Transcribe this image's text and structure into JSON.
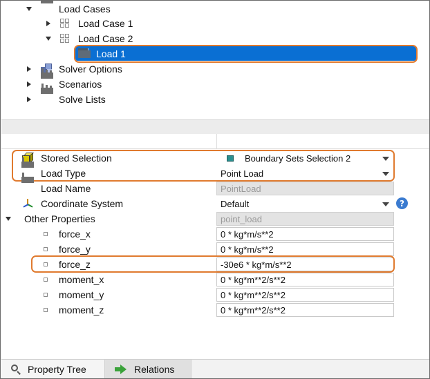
{
  "tree": {
    "items": [
      {
        "label": "Load Cases",
        "icon": "factory-icon",
        "expanded": true
      },
      {
        "label": "Load Case 1",
        "icon": "grid-icon",
        "expanded": false
      },
      {
        "label": "Load Case 2",
        "icon": "grid-icon",
        "expanded": true
      },
      {
        "label": "Load 1",
        "icon": "folder-icon",
        "selected": true
      },
      {
        "label": "Solver Options",
        "icon": "solver-icon",
        "expanded": false
      },
      {
        "label": "Scenarios",
        "icon": "factory-icon",
        "expanded": false
      },
      {
        "label": "Solve Lists",
        "icon": "factory-icon",
        "expanded": false
      }
    ]
  },
  "properties": {
    "stored_selection": {
      "label": "Stored Selection",
      "value": "Boundary Sets Selection 2",
      "icon": "cube-icon"
    },
    "load_type": {
      "label": "Load Type",
      "value": "Point Load",
      "icon": "factory-icon"
    },
    "load_name": {
      "label": "Load Name",
      "value": "PointLoad",
      "icon": "factory-icon"
    },
    "coordinate_system": {
      "label": "Coordinate System",
      "value": "Default",
      "icon": "axes-icon"
    },
    "other_properties": {
      "label": "Other Properties",
      "value": "point_load"
    },
    "force_x": {
      "label": "force_x",
      "value": "0 * kg*m/s**2"
    },
    "force_y": {
      "label": "force_y",
      "value": "0 * kg*m/s**2"
    },
    "force_z": {
      "label": "force_z",
      "value": "-30e6 * kg*m/s**2"
    },
    "moment_x": {
      "label": "moment_x",
      "value": "0 * kg*m**2/s**2"
    },
    "moment_y": {
      "label": "moment_y",
      "value": "0 * kg*m**2/s**2"
    },
    "moment_z": {
      "label": "moment_z",
      "value": "0 * kg*m**2/s**2"
    }
  },
  "help_glyph": "?",
  "tabs": [
    {
      "label": "Property Tree",
      "icon": "search-icon",
      "active": true
    },
    {
      "label": "Relations",
      "icon": "arrow-right-icon",
      "active": false
    }
  ],
  "colors": {
    "selection": "#0a6fd3",
    "callout": "#e07a2e"
  }
}
